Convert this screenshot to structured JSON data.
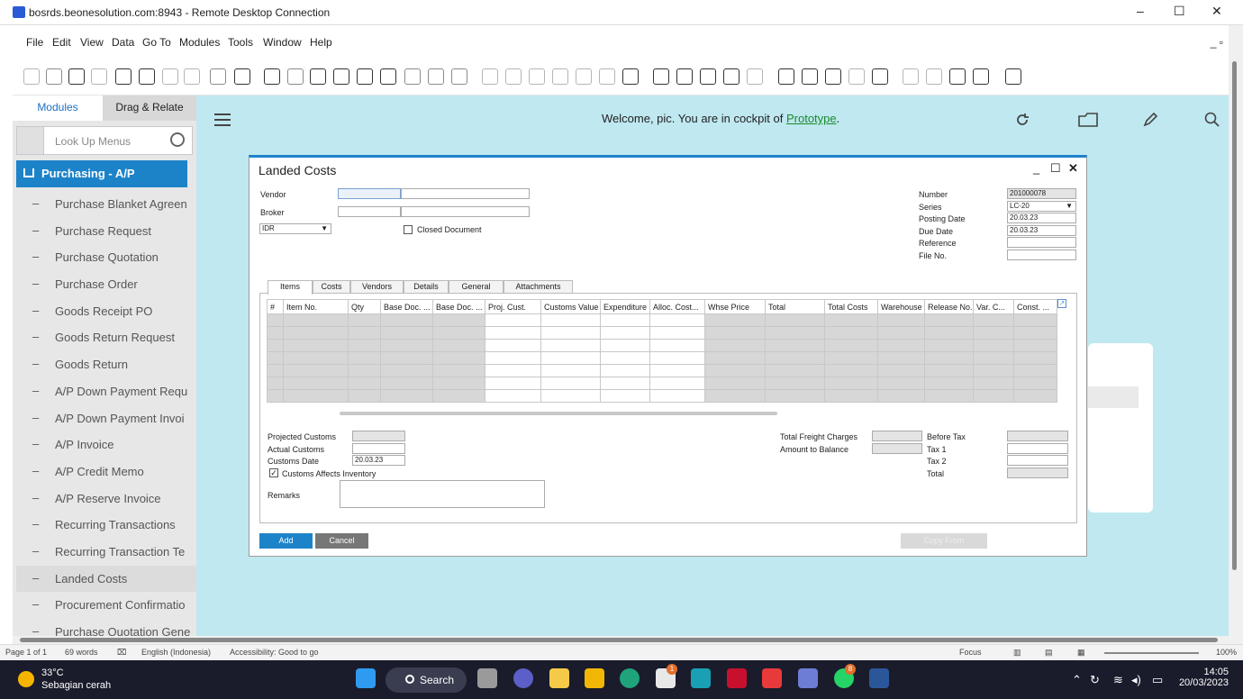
{
  "window": {
    "title": "bosrds.beonesolution.com:8943 - Remote Desktop Connection",
    "min": "–",
    "max": "☐",
    "close": "✕"
  },
  "menu": {
    "file": "File",
    "edit": "Edit",
    "view": "View",
    "data": "Data",
    "goto": "Go To",
    "modules": "Modules",
    "tools": "Tools",
    "window": "Window",
    "help": "Help",
    "restore": "_ ▫"
  },
  "sidebar": {
    "tab_modules": "Modules",
    "tab_drag": "Drag & Relate",
    "lookup_placeholder": "Look Up Menus",
    "module_title": "Purchasing - A/P",
    "items": [
      {
        "label": "Purchase Blanket Agreen"
      },
      {
        "label": "Purchase Request"
      },
      {
        "label": "Purchase Quotation"
      },
      {
        "label": "Purchase Order"
      },
      {
        "label": "Goods Receipt PO"
      },
      {
        "label": "Goods Return Request"
      },
      {
        "label": "Goods Return"
      },
      {
        "label": "A/P Down Payment Requ"
      },
      {
        "label": "A/P Down Payment Invoi"
      },
      {
        "label": "A/P Invoice"
      },
      {
        "label": "A/P Credit Memo"
      },
      {
        "label": "A/P Reserve Invoice"
      },
      {
        "label": "Recurring Transactions"
      },
      {
        "label": "Recurring Transaction Te"
      },
      {
        "label": "Landed Costs"
      },
      {
        "label": "Procurement Confirmatio"
      },
      {
        "label": "Purchase Quotation Gene"
      }
    ]
  },
  "cockpit": {
    "welcome_prefix": "Welcome, pic. You are in cockpit of ",
    "cockpit_name": "Prototype",
    "period": "."
  },
  "dialog": {
    "title": "Landed Costs",
    "vendor_label": "Vendor",
    "broker_label": "Broker",
    "currency": "IDR",
    "closed_document": "Closed Document",
    "number_label": "Number",
    "number_value": "201000078",
    "series_label": "Series",
    "series_value": "LC-20",
    "posting_date_label": "Posting Date",
    "posting_date": "20.03.23",
    "due_date_label": "Due Date",
    "due_date": "20.03.23",
    "reference_label": "Reference",
    "file_no_label": "File No.",
    "tabs": [
      "Items",
      "Costs",
      "Vendors",
      "Details",
      "General",
      "Attachments"
    ],
    "columns": [
      "#",
      "Item No.",
      "Qty",
      "Base Doc. ...",
      "Base Doc. ...",
      "Proj. Cust.",
      "Customs Value",
      "Expenditure",
      "Alloc. Cost...",
      "Whse Price",
      "Total",
      "Total Costs",
      "Warehouse",
      "Release No.",
      "Var. C...",
      "Const. ..."
    ],
    "projected_customs": "Projected Customs",
    "actual_customs": "Actual Customs",
    "customs_date_label": "Customs Date",
    "customs_date": "20.03.23",
    "customs_affects": "Customs Affects Inventory",
    "remarks": "Remarks",
    "total_freight": "Total Freight Charges",
    "amount_to_balance": "Amount to Balance",
    "before_tax": "Before Tax",
    "tax1": "Tax 1",
    "tax2": "Tax 2",
    "total": "Total",
    "add": "Add",
    "cancel": "Cancel",
    "copy_from": "Copy From"
  },
  "statusbar": {
    "page": "Page 1 of 1",
    "words": "69 words",
    "lang": "English (Indonesia)",
    "access": "Accessibility: Good to go",
    "focus": "Focus",
    "zoom": "100%"
  },
  "taskbar": {
    "temp": "33°C",
    "condition": "Sebagian cerah",
    "search": "Search",
    "time": "14:05",
    "date": "20/03/2023",
    "badge1": "1",
    "badge8": "8"
  },
  "colors": {
    "accent": "#1d83c9",
    "cockpit_bg": "#bfe8f0",
    "link": "#1b8a2e"
  }
}
